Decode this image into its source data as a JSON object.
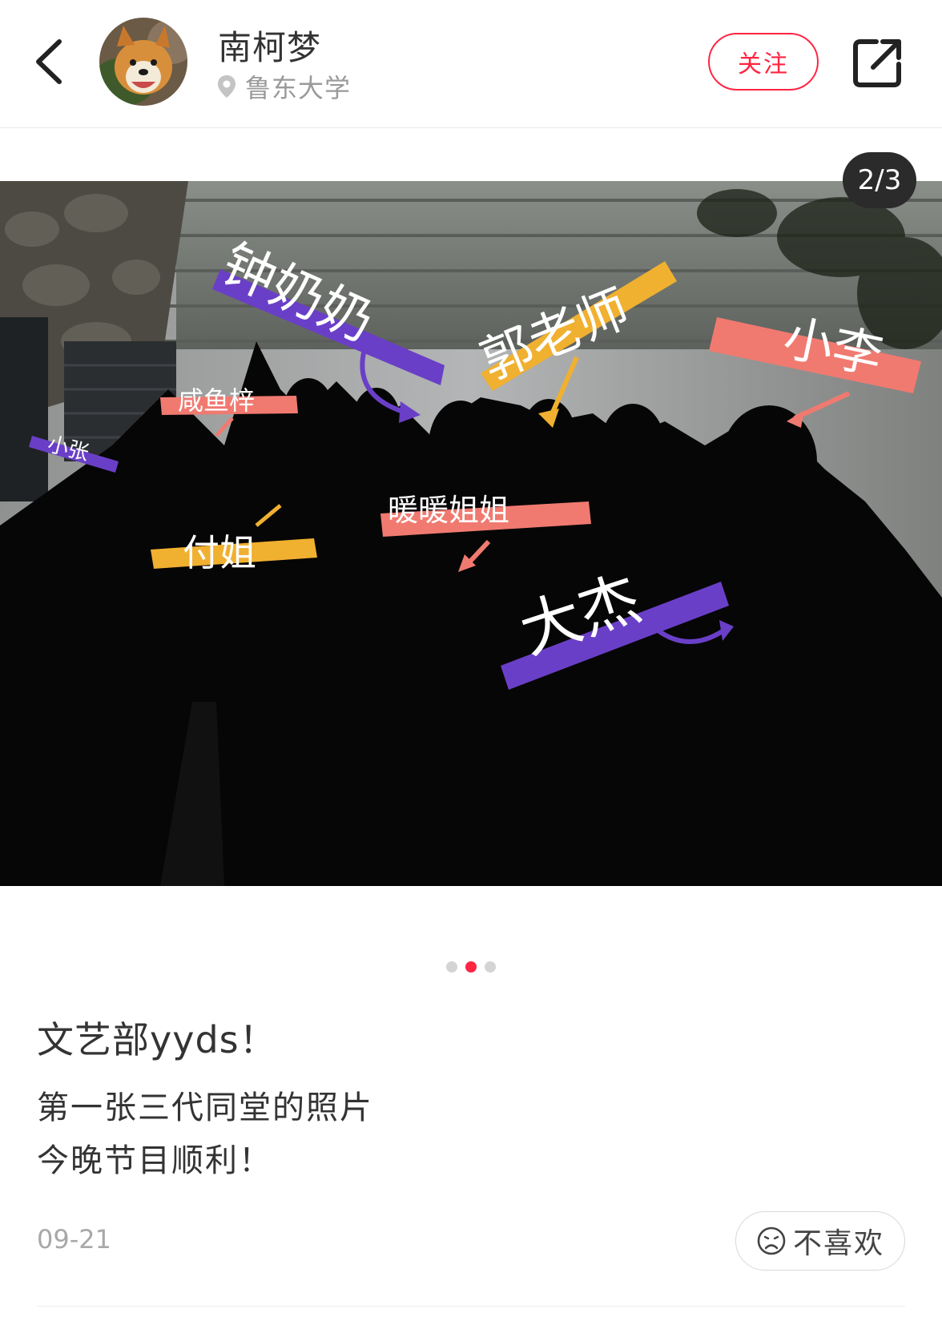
{
  "header": {
    "author_name": "南柯梦",
    "location": "鲁东大学",
    "follow_label": "关注",
    "icons": {
      "back": "back-arrow-icon",
      "location": "location-pin-icon",
      "share": "share-icon"
    }
  },
  "photo": {
    "counter": "2/3",
    "labels": [
      {
        "text": "钟奶奶",
        "color": "#6a3fc7"
      },
      {
        "text": "郭老师",
        "color": "#f0b030"
      },
      {
        "text": "小李",
        "color": "#f07a70"
      },
      {
        "text": "咸鱼梓",
        "color": "#f07a70"
      },
      {
        "text": "小张",
        "color": "#6a3fc7"
      },
      {
        "text": "暖暖姐姐",
        "color": "#f07a70"
      },
      {
        "text": "付姐",
        "color": "#f0b030"
      },
      {
        "text": "大杰",
        "color": "#6a3fc7"
      }
    ]
  },
  "carousel": {
    "total": 3,
    "active": 2
  },
  "post": {
    "title": "文艺部yyds！",
    "body_lines": [
      "第一张三代同堂的照片",
      "今晚节目顺利！"
    ],
    "date": "09-21",
    "dislike_label": "不喜欢"
  },
  "colors": {
    "accent": "#ff2442"
  }
}
